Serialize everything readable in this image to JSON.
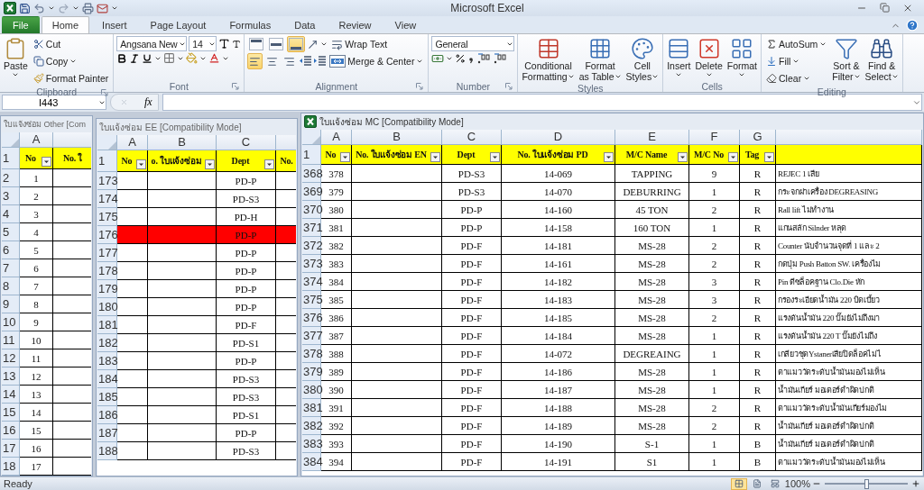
{
  "title_bar": {
    "title": "Microsoft Excel"
  },
  "tabs": [
    {
      "label": "File",
      "kind": "file",
      "selected": false
    },
    {
      "label": "Home",
      "kind": "tab",
      "selected": true
    },
    {
      "label": "Insert",
      "kind": "tab",
      "selected": false
    },
    {
      "label": "Page Layout",
      "kind": "tab",
      "selected": false
    },
    {
      "label": "Formulas",
      "kind": "tab",
      "selected": false
    },
    {
      "label": "Data",
      "kind": "tab",
      "selected": false
    },
    {
      "label": "Review",
      "kind": "tab",
      "selected": false
    },
    {
      "label": "View",
      "kind": "tab",
      "selected": false
    }
  ],
  "clipboard": {
    "label": "Clipboard",
    "paste": "Paste",
    "cut": "Cut",
    "copy": "Copy",
    "format_painter": "Format Painter"
  },
  "font": {
    "label": "Font",
    "name": "Angsana New",
    "size": "14"
  },
  "alignment": {
    "label": "Alignment",
    "vertical": [
      {
        "selected": false
      },
      {
        "selected": false
      },
      {
        "selected": true
      }
    ],
    "horizontal": [
      {
        "selected": true
      },
      {
        "selected": false
      },
      {
        "selected": false
      }
    ],
    "wrap_text": "Wrap Text",
    "merge_center": "Merge & Center"
  },
  "number": {
    "label": "Number",
    "format": "General"
  },
  "styles": {
    "label": "Styles",
    "buttons": [
      {
        "lines": [
          "Conditional",
          "Formatting"
        ]
      },
      {
        "lines": [
          "Format",
          "as Table"
        ]
      },
      {
        "lines": [
          "Cell",
          "Styles"
        ]
      }
    ]
  },
  "cells": {
    "label": "Cells",
    "buttons": [
      {
        "lines": [
          "Insert"
        ]
      },
      {
        "lines": [
          "Delete"
        ]
      },
      {
        "lines": [
          "Format"
        ]
      }
    ]
  },
  "editing": {
    "label": "Editing",
    "autosum": "AutoSum",
    "fill": "Fill",
    "clear": "Clear",
    "buttons": [
      {
        "lines": [
          "Sort &",
          "Filter"
        ]
      },
      {
        "lines": [
          "Find &",
          "Select"
        ]
      }
    ]
  },
  "formula_bar": {
    "name_box": "I443",
    "fx": "fx"
  },
  "workbooks": [
    {
      "title": "ใบแจ้งซ่อม Other [Com",
      "active": false,
      "header_row": "1",
      "columns": [
        {
          "letter": "A",
          "header": "No",
          "filter": true,
          "kind": "centered"
        },
        {
          "header": "No. ใ",
          "filter": false,
          "kind": "centered"
        }
      ],
      "rows": [
        {
          "num": "2",
          "cells": [
            "1",
            null
          ],
          "highlighted": false
        },
        {
          "num": "3",
          "cells": [
            "2",
            null
          ],
          "highlighted": false
        },
        {
          "num": "4",
          "cells": [
            "3",
            null
          ],
          "highlighted": false
        },
        {
          "num": "5",
          "cells": [
            "4",
            null
          ],
          "highlighted": false
        },
        {
          "num": "6",
          "cells": [
            "5",
            null
          ],
          "highlighted": false
        },
        {
          "num": "7",
          "cells": [
            "6",
            null
          ],
          "highlighted": false
        },
        {
          "num": "8",
          "cells": [
            "7",
            null
          ],
          "highlighted": false
        },
        {
          "num": "9",
          "cells": [
            "8",
            null
          ],
          "highlighted": false
        },
        {
          "num": "10",
          "cells": [
            "9",
            null
          ],
          "highlighted": false
        },
        {
          "num": "11",
          "cells": [
            "10",
            null
          ],
          "highlighted": false
        },
        {
          "num": "12",
          "cells": [
            "11",
            null
          ],
          "highlighted": false
        },
        {
          "num": "13",
          "cells": [
            "12",
            null
          ],
          "highlighted": false
        },
        {
          "num": "14",
          "cells": [
            "13",
            null
          ],
          "highlighted": false
        },
        {
          "num": "15",
          "cells": [
            "14",
            null
          ],
          "highlighted": false
        },
        {
          "num": "16",
          "cells": [
            "15",
            null
          ],
          "highlighted": false
        },
        {
          "num": "17",
          "cells": [
            "16",
            null
          ],
          "highlighted": false
        },
        {
          "num": "18",
          "cells": [
            "17",
            null
          ],
          "highlighted": false
        }
      ]
    },
    {
      "title": "ใบแจ้งซ่อม EE [Compatibility Mode]",
      "active": false,
      "header_row": "1",
      "columns": [
        {
          "letter": "A",
          "header": "No",
          "filter": true,
          "kind": "centered"
        },
        {
          "letter": "B",
          "header": "o. ใบแจ้งซ่อม",
          "filter": true,
          "kind": "centered"
        },
        {
          "letter": "C",
          "header": "Dept",
          "filter": true,
          "kind": "centered"
        },
        {
          "header": "No.",
          "filter": false,
          "kind": "centered"
        }
      ],
      "rows": [
        {
          "num": "173",
          "cells": [
            null,
            null,
            "PD-P",
            null
          ],
          "highlighted": false
        },
        {
          "num": "174",
          "cells": [
            null,
            null,
            "PD-S3",
            null
          ],
          "highlighted": false
        },
        {
          "num": "175",
          "cells": [
            null,
            null,
            "PD-H",
            null
          ],
          "highlighted": false
        },
        {
          "num": "176",
          "cells": [
            null,
            null,
            "PD-P",
            null
          ],
          "highlighted": true
        },
        {
          "num": "177",
          "cells": [
            null,
            null,
            "PD-P",
            null
          ],
          "highlighted": false
        },
        {
          "num": "178",
          "cells": [
            null,
            null,
            "PD-P",
            null
          ],
          "highlighted": false
        },
        {
          "num": "179",
          "cells": [
            null,
            null,
            "PD-P",
            null
          ],
          "highlighted": false
        },
        {
          "num": "180",
          "cells": [
            null,
            null,
            "PD-P",
            null
          ],
          "highlighted": false
        },
        {
          "num": "181",
          "cells": [
            null,
            null,
            "PD-F",
            null
          ],
          "highlighted": false
        },
        {
          "num": "182",
          "cells": [
            null,
            null,
            "PD-S1",
            null
          ],
          "highlighted": false
        },
        {
          "num": "183",
          "cells": [
            null,
            null,
            "PD-P",
            null
          ],
          "highlighted": false
        },
        {
          "num": "184",
          "cells": [
            null,
            null,
            "PD-S3",
            null
          ],
          "highlighted": false
        },
        {
          "num": "185",
          "cells": [
            null,
            null,
            "PD-S3",
            null
          ],
          "highlighted": false
        },
        {
          "num": "186",
          "cells": [
            null,
            null,
            "PD-S1",
            null
          ],
          "highlighted": false
        },
        {
          "num": "187",
          "cells": [
            null,
            null,
            "PD-P",
            null
          ],
          "highlighted": false
        },
        {
          "num": "188",
          "cells": [
            null,
            null,
            "PD-S3",
            null
          ],
          "highlighted": false
        }
      ]
    },
    {
      "title": "ใบแจ้งซ่อม MC  [Compatibility Mode]",
      "active": true,
      "header_row": "1",
      "columns": [
        {
          "letter": "A",
          "header": "No",
          "filter": true,
          "kind": "centered"
        },
        {
          "letter": "B",
          "header": "No. ใบแจ้งซ่อม EN",
          "filter": true,
          "kind": "centered"
        },
        {
          "letter": "C",
          "header": "Dept",
          "filter": true,
          "kind": "centered"
        },
        {
          "letter": "D",
          "header": "No. ใบแจ้งซ่อม PD",
          "filter": true,
          "kind": "centered"
        },
        {
          "letter": "E",
          "header": "M/C Name",
          "filter": true,
          "kind": "centered"
        },
        {
          "letter": "F",
          "header": "M/C No",
          "filter": true,
          "kind": "centered"
        },
        {
          "letter": "G",
          "header": "Tag",
          "filter": true,
          "kind": "centered"
        },
        {
          "filter": false,
          "kind": "left"
        }
      ],
      "rows": [
        {
          "num": "368",
          "cells": [
            "378",
            null,
            "PD-S3",
            "14-069",
            "TAPPING",
            "9",
            "R",
            "REJEC 1 เสีย"
          ],
          "highlighted": false
        },
        {
          "num": "369",
          "cells": [
            "379",
            null,
            "PD-S3",
            "14-070",
            "DEBURRING",
            "1",
            "R",
            "กระจกฝาเครื่อง DEGREASING"
          ],
          "highlighted": false
        },
        {
          "num": "370",
          "cells": [
            "380",
            null,
            "PD-P",
            "14-160",
            "45 TON",
            "2",
            "R",
            "Rall  lift ไม่ทำงาน"
          ],
          "highlighted": false
        },
        {
          "num": "371",
          "cells": [
            "381",
            null,
            "PD-P",
            "14-158",
            "160 TON",
            "1",
            "R",
            "แกนสลัก Silnder หลุด"
          ],
          "highlighted": false
        },
        {
          "num": "372",
          "cells": [
            "382",
            null,
            "PD-F",
            "14-181",
            "MS-28",
            "2",
            "R",
            "Counter นับจำนวนจุดที่ 1 และ 2"
          ],
          "highlighted": false
        },
        {
          "num": "373",
          "cells": [
            "383",
            null,
            "PD-F",
            "14-161",
            "MS-28",
            "2",
            "R",
            "กดปุ่ม Push Batton SW. เครื่องไม"
          ],
          "highlighted": false
        },
        {
          "num": "374",
          "cells": [
            "384",
            null,
            "PD-F",
            "14-182",
            "MS-28",
            "3",
            "R",
            "Pin ดีซล็อคฐาน Clo.Die หัก"
          ],
          "highlighted": false
        },
        {
          "num": "375",
          "cells": [
            "385",
            null,
            "PD-F",
            "14-183",
            "MS-28",
            "3",
            "R",
            "กรองระเอียดน้ำมัน 220 บิดเบี้ยว"
          ],
          "highlighted": false
        },
        {
          "num": "376",
          "cells": [
            "386",
            null,
            "PD-F",
            "14-185",
            "MS-28",
            "2",
            "R",
            "แรงดันน้ำมัน 220 ปั๊มยังไม่ถึงมา"
          ],
          "highlighted": false
        },
        {
          "num": "377",
          "cells": [
            "387",
            null,
            "PD-F",
            "14-184",
            "MS-28",
            "1",
            "R",
            "แรงดันน้ำมัน 220 T ปั๊มยังไม่ถึง"
          ],
          "highlighted": false
        },
        {
          "num": "378",
          "cells": [
            "388",
            null,
            "PD-F",
            "14-072",
            "DEGREAING",
            "1",
            "R",
            "เกลียวชุดYstanerเสียปิดล็อคไม่ไ"
          ],
          "highlighted": false
        },
        {
          "num": "379",
          "cells": [
            "389",
            null,
            "PD-F",
            "14-186",
            "MS-28",
            "1",
            "R",
            "ตาแมววัดระดับน้ำมันมองไม่เห็น"
          ],
          "highlighted": false
        },
        {
          "num": "380",
          "cells": [
            "390",
            null,
            "PD-F",
            "14-187",
            "MS-28",
            "1",
            "R",
            "น้ำมันเกียร์ มอเตอร์ดำผิดปกติ"
          ],
          "highlighted": false
        },
        {
          "num": "381",
          "cells": [
            "391",
            null,
            "PD-F",
            "14-188",
            "MS-28",
            "2",
            "R",
            "ตาแมววัดระดับน้ำมันเกียร์มองไม"
          ],
          "highlighted": false
        },
        {
          "num": "382",
          "cells": [
            "392",
            null,
            "PD-F",
            "14-189",
            "MS-28",
            "2",
            "R",
            "น้ำมันเกียร์ มอเตอร์ดำผิดปกติ"
          ],
          "highlighted": false
        },
        {
          "num": "383",
          "cells": [
            "393",
            null,
            "PD-F",
            "14-190",
            "S-1",
            "1",
            "B",
            "น้ำมันเกียร์ มอเตอร์ดำผิดปกติ"
          ],
          "highlighted": false
        },
        {
          "num": "384",
          "cells": [
            "394",
            null,
            "PD-F",
            "14-191",
            "S1",
            "1",
            "B",
            "ตาแมววัดระดับน้ำมันมองไม่เห็น"
          ],
          "highlighted": false
        }
      ]
    }
  ],
  "status_bar": {
    "status": "Ready",
    "views": [
      {
        "selected": true
      },
      {
        "selected": false
      },
      {
        "selected": false
      }
    ],
    "zoom": "100%",
    "zoom_slider": {
      "level": 0.5
    }
  }
}
